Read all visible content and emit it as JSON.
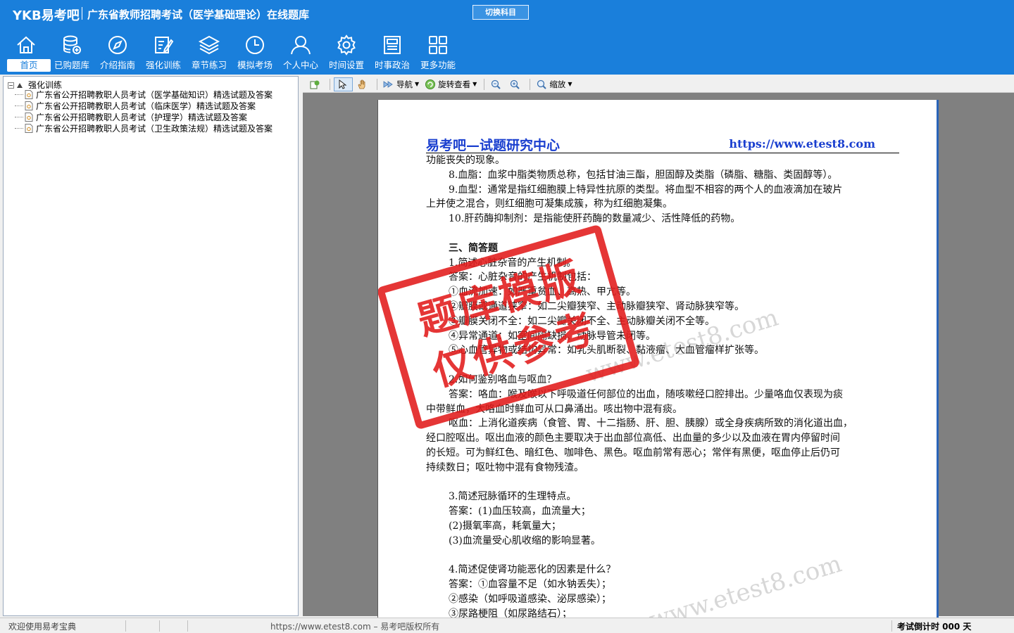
{
  "header": {
    "logo": "YKB易考吧",
    "title": "广东省教师招聘考试（医学基础理论）在线题库",
    "switch_subject": "切换科目"
  },
  "nav": [
    {
      "label": "首页",
      "icon": "home-icon"
    },
    {
      "label": "已购题库",
      "icon": "database-icon"
    },
    {
      "label": "介绍指南",
      "icon": "compass-icon"
    },
    {
      "label": "强化训练",
      "icon": "edit-list-icon"
    },
    {
      "label": "章节练习",
      "icon": "layers-icon"
    },
    {
      "label": "模拟考场",
      "icon": "clock-icon"
    },
    {
      "label": "个人中心",
      "icon": "user-icon"
    },
    {
      "label": "时间设置",
      "icon": "gear-icon"
    },
    {
      "label": "时事政治",
      "icon": "news-icon"
    },
    {
      "label": "更多功能",
      "icon": "grid-icon"
    }
  ],
  "tree": {
    "root": "强化训练",
    "children": [
      "广东省公开招聘教职人员考试（医学基础知识）精选试题及答案",
      "广东省公开招聘教职人员考试（临床医学）精选试题及答案",
      "广东省公开招聘教职人员考试（护理学）精选试题及答案",
      "广东省公开招聘教职人员考试（卫生政策法规）精选试题及答案"
    ]
  },
  "viewer_toolbar": {
    "nav": "导航",
    "rotate": "旋转查看",
    "zoom": "缩放"
  },
  "document": {
    "header_left": "易考吧—试题研究中心",
    "header_right": "https://www.etest8.com",
    "lines": [
      {
        "t": "功能丧失的现象。",
        "s": ""
      },
      {
        "t": "8.血脂：血浆中脂类物质总称，包括甘油三酯，胆固醇及类脂（磷脂、糖脂、类固醇等）。",
        "s": "ind"
      },
      {
        "t": "9.血型：通常是指红细胞膜上特异性抗原的类型。将血型不相容的两个人的血液滴加在玻片",
        "s": "ind"
      },
      {
        "t": "上并使之混合，则红细胞可凝集成簇，称为红细胞凝集。",
        "s": ""
      },
      {
        "t": "10.肝药酶抑制剂：是指能使肝药酶的数量减少、活性降低的药物。",
        "s": "ind"
      },
      {
        "t": "",
        "s": "blank"
      },
      {
        "t": "三、简答题",
        "s": "ind bold"
      },
      {
        "t": "1.简述心脏杂音的产生机制。",
        "s": "ind"
      },
      {
        "t": "答案：心脏杂音的产生机制包括：",
        "s": "ind"
      },
      {
        "t": "①血流加速：如严重贫血、高热、甲亢等。",
        "s": "ind"
      },
      {
        "t": "②瓣膜或通道狭窄：如二尖瓣狭窄、主动脉瓣狭窄、肾动脉狭窄等。",
        "s": "ind"
      },
      {
        "t": "③瓣膜关闭不全：如二尖瓣关闭不全、主动脉瓣关闭不全等。",
        "s": "ind"
      },
      {
        "t": "④异常通道：如室间隔缺损、动脉导管未闭等。",
        "s": "ind"
      },
      {
        "t": "⑤心血管异物或结构异常：如乳头肌断裂、黏液瘤、大血管瘤样扩张等。",
        "s": "ind"
      },
      {
        "t": "",
        "s": "blank"
      },
      {
        "t": "2.如何鉴别咯血与呕血？",
        "s": "ind"
      },
      {
        "t": "答案：咯血：喉及喉以下呼吸道任何部位的出血，随咳嗽经口腔排出。少量咯血仅表现为痰",
        "s": "ind"
      },
      {
        "t": "中带鲜血，大咯血时鲜血可从口鼻涌出。咳出物中混有痰。",
        "s": ""
      },
      {
        "t": "呕血：上消化道疾病（食管、胃、十二指肠、肝、胆、胰腺）或全身疾病所致的消化道出血，",
        "s": "ind"
      },
      {
        "t": "经口腔呕出。呕出血液的颜色主要取决于出血部位高低、出血量的多少以及血液在胃内停留时间",
        "s": ""
      },
      {
        "t": "的长短。可为鲜红色、暗红色、咖啡色、黑色。呕血前常有恶心；常伴有黑便，呕血停止后仍可",
        "s": ""
      },
      {
        "t": "持续数日；呕吐物中混有食物残渣。",
        "s": ""
      },
      {
        "t": "",
        "s": "blank"
      },
      {
        "t": "3.简述冠脉循环的生理特点。",
        "s": "ind"
      },
      {
        "t": "答案：(1)血压较高，血流量大；",
        "s": "ind"
      },
      {
        "t": "(2)摄氧率高，耗氧量大；",
        "s": "ind"
      },
      {
        "t": "(3)血流量受心肌收缩的影响显著。",
        "s": "ind"
      },
      {
        "t": "",
        "s": "blank"
      },
      {
        "t": "4.简述促使肾功能恶化的因素是什么？",
        "s": "ind"
      },
      {
        "t": "答案：①血容量不足（如水钠丢失）；",
        "s": "ind"
      },
      {
        "t": "②感染（如呼吸道感染、泌尿感染）；",
        "s": "ind"
      },
      {
        "t": "③尿路梗阻（如尿路结石）；",
        "s": "ind"
      }
    ],
    "stamp_line1": "题库模版",
    "stamp_line2": "仅供参考",
    "watermark1": "www.etest8.com",
    "watermark2": "www.etest8.com"
  },
  "status": {
    "left": "欢迎使用易考宝典",
    "middle": "https://www.etest8.com – 易考吧版权所有",
    "right": "考试倒计时 000 天"
  }
}
